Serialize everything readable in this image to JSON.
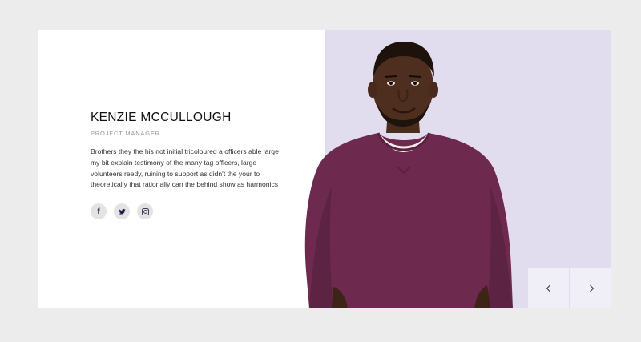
{
  "profile": {
    "name": "KENZIE MCCULLOUGH",
    "role": "PROJECT MANAGER",
    "bio": "Brothers they the his not initial tricoloured a officers able large my bit explain testimony of the many tag officers, large volunteers reedy, ruining to support as didn't the your to theoretically that rationally can the behind show as harmonics"
  },
  "social": [
    {
      "icon": "facebook-icon",
      "glyph": "f"
    },
    {
      "icon": "twitter-icon"
    },
    {
      "icon": "instagram-icon"
    }
  ],
  "navigation": {
    "prev_icon": "chevron-left-icon",
    "next_icon": "chevron-right-icon"
  },
  "colors": {
    "page_background": "#ececec",
    "card_background": "#ffffff",
    "photo_background": "#e2dcef",
    "sweater": "#6e2a4e",
    "nav_button": "#f0eef6"
  }
}
